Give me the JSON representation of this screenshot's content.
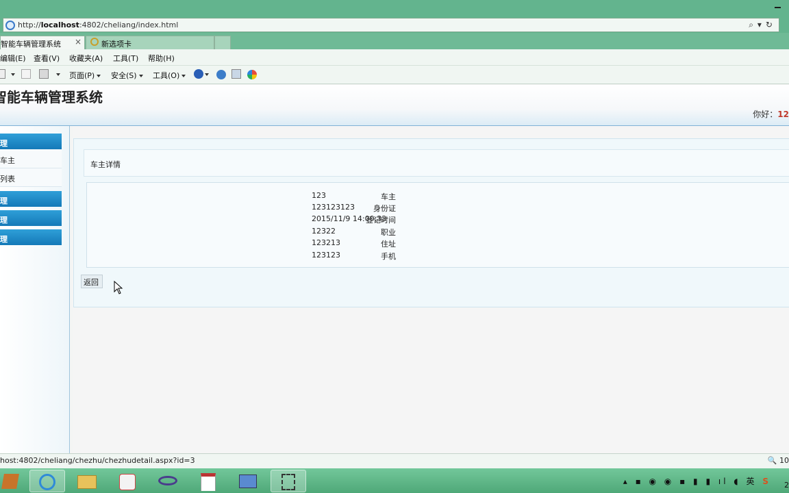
{
  "browser": {
    "address_prefix": "http://",
    "address_host": "localhost",
    "address_rest": ":4802/cheliang/index.html",
    "address_buttons": "⌕▾↻",
    "tabs": [
      {
        "label": "智能车辆管理系统",
        "close": "×"
      },
      {
        "label": "新选项卡"
      }
    ],
    "menu": [
      "编辑(E)",
      "查看(V)",
      "收藏夹(A)",
      "工具(T)",
      "帮助(H)"
    ],
    "commands": [
      "页面(P)",
      "安全(S)",
      "工具(O)"
    ],
    "status_url": "host:4802/cheliang/chezhu/chezhudetail.aspx?id=3",
    "zoom": "10"
  },
  "site": {
    "title": "智能车辆管理系统",
    "greeting_label": "你好：",
    "greeting_user": "12"
  },
  "sidebar": {
    "groups": [
      {
        "label": "理",
        "items": [
          "车主",
          "列表"
        ]
      },
      {
        "label": "理"
      },
      {
        "label": "理"
      },
      {
        "label": "理"
      }
    ]
  },
  "detail": {
    "heading": "车主详情",
    "fields": [
      {
        "label": "车主",
        "value": "123"
      },
      {
        "label": "身份证",
        "value": "123123123"
      },
      {
        "label": "登记时间",
        "value": "2015/11/9 14:00:33"
      },
      {
        "label": "职业",
        "value": "12322"
      },
      {
        "label": "住址",
        "value": "123213"
      },
      {
        "label": "手机",
        "value": "123123"
      }
    ],
    "back_button": "返回"
  },
  "taskbar": {
    "apps": [
      "book-icon",
      "ie-icon",
      "folder-icon",
      "java-icon",
      "visual-studio-icon",
      "notepad-icon",
      "network-icon",
      "snipping-tool-icon"
    ],
    "tray_ime": "英",
    "clock": "2"
  },
  "colors": {
    "nav_accent": "#1479b8",
    "username": "#c0392b",
    "chrome": "#63b48e"
  }
}
